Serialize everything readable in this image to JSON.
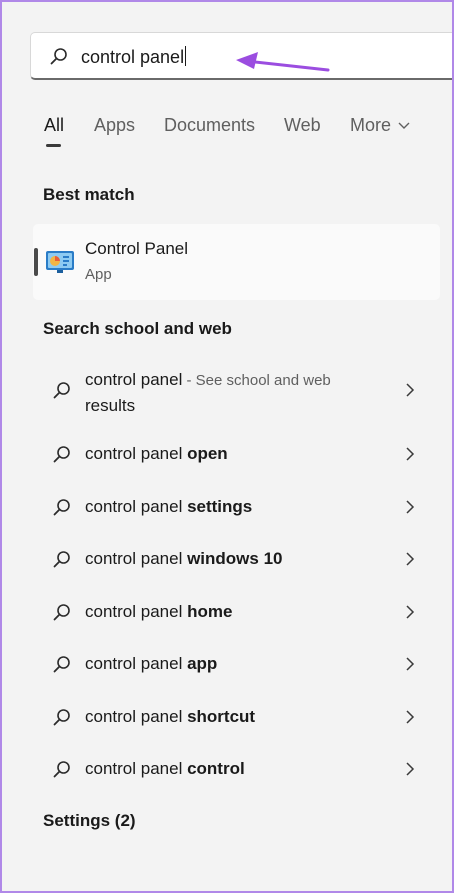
{
  "search": {
    "value": "control panel"
  },
  "tabs": [
    {
      "label": "All"
    },
    {
      "label": "Apps"
    },
    {
      "label": "Documents"
    },
    {
      "label": "Web"
    },
    {
      "label": "More"
    }
  ],
  "best_match": {
    "heading": "Best match",
    "title": "Control Panel",
    "subtitle": "App"
  },
  "web_section": {
    "heading": "Search school and web"
  },
  "results": [
    {
      "prefix": "control panel",
      "suffix": " - See school and web",
      "wrap": "results"
    },
    {
      "prefix": "control panel ",
      "bold": "open"
    },
    {
      "prefix": "control panel ",
      "bold": "settings"
    },
    {
      "prefix": "control panel ",
      "bold": "windows 10"
    },
    {
      "prefix": "control panel ",
      "bold": "home"
    },
    {
      "prefix": "control panel ",
      "bold": "app"
    },
    {
      "prefix": "control panel ",
      "bold": "shortcut"
    },
    {
      "prefix": "control panel ",
      "bold": "control"
    }
  ],
  "settings_section": {
    "heading": "Settings (2)"
  },
  "colors": {
    "annotation_arrow": "#9b4de0",
    "frame": "#b088e8",
    "background": "#f3f3f3"
  }
}
